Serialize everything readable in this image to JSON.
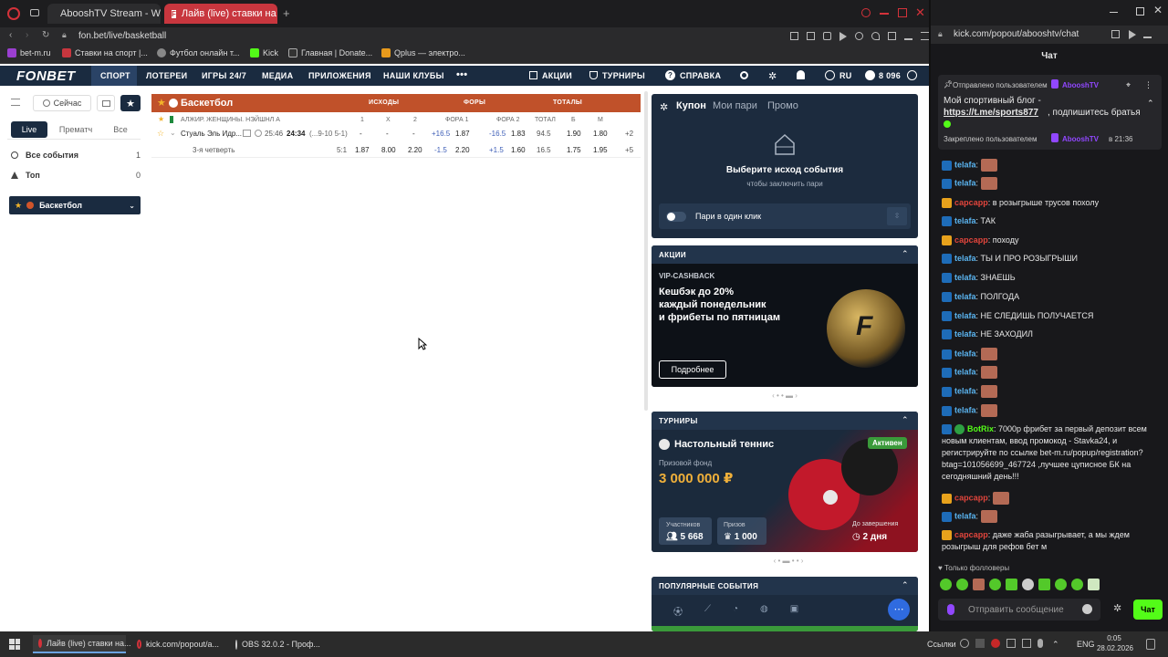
{
  "browser_left": {
    "tabs": [
      {
        "label": "AbooshTV Stream - Watch"
      },
      {
        "label": "Лайв (live) ставки на Баск"
      }
    ],
    "url": "fon.bet/live/basketball",
    "bookmarks": [
      {
        "label": "bet-m.ru"
      },
      {
        "label": "Ставки на спорт |..."
      },
      {
        "label": "Футбол онлайн т..."
      },
      {
        "label": "Kick"
      },
      {
        "label": "Главная | Donate..."
      },
      {
        "label": "Qplus — электро..."
      }
    ]
  },
  "site": {
    "logo": "FONBET",
    "nav": [
      "СПОРТ",
      "ЛОТЕРЕИ",
      "ИГРЫ 24/7",
      "МЕДИА",
      "ПРИЛОЖЕНИЯ",
      "НАШИ КЛУБЫ",
      "•••"
    ],
    "nav_right": [
      "АКЦИИ",
      "ТУРНИРЫ",
      "СПРАВКА"
    ],
    "lang": "RU",
    "balance": "8 096"
  },
  "sidebar": {
    "now_label": "Сейчас",
    "tabs": [
      "Live",
      "Прематч",
      "Все"
    ],
    "items": [
      {
        "label": "Все события",
        "count": "1"
      },
      {
        "label": "Топ",
        "count": "0"
      }
    ],
    "sport": "Баскетбол"
  },
  "board": {
    "sport_title": "Баскетбол",
    "groups": [
      "ИСХОДЫ",
      "ФОРЫ",
      "ТОТАЛЫ"
    ],
    "league": "АЛЖИР. ЖЕНЩИНЫ. НЭЙШНЛ А",
    "cols": [
      "1",
      "X",
      "2",
      "ФОРА 1",
      "ФОРА 2",
      "ТОТАЛ",
      "Б",
      "М"
    ],
    "event": {
      "name": "Стуаль Эль Идр...",
      "score": "25:46",
      "time": "24:34",
      "periods": "(...9-10 5-1)",
      "odds": [
        "-",
        "-",
        "-",
        "+16.5",
        "1.87",
        "-16.5",
        "1.83",
        "94.5",
        "1.90",
        "1.80",
        "+2"
      ]
    },
    "period_row": {
      "label": "3-я четверть",
      "score": "5:1",
      "odds": [
        "1.87",
        "8.00",
        "2.20",
        "-1.5",
        "2.20",
        "+1.5",
        "1.60",
        "16.5",
        "1.75",
        "1.95",
        "+5"
      ]
    }
  },
  "coupon": {
    "tabs": [
      "Купон",
      "Мои пари",
      "Промо"
    ],
    "title": "Выберите исход события",
    "subtitle": "чтобы заключить пари",
    "one_click": "Пари в один клик"
  },
  "promos": {
    "header": "АКЦИИ",
    "tag": "VIP-CASHBACK",
    "text": "Кешбэк до 20%\nкаждый понедельник\nи фрибеты по пятницам",
    "button": "Подробнее"
  },
  "tournaments": {
    "header": "ТУРНИРЫ",
    "name": "Настольный теннис",
    "badge": "Активен",
    "fund_label": "Призовой фонд",
    "fund": "3 000 000 ₽",
    "participants_label": "Участников",
    "participants": "5 668",
    "prizes_label": "Призов",
    "prizes": "1 000",
    "end_label": "До завершения",
    "end": "2 дня"
  },
  "popular": {
    "header": "ПОПУЛЯРНЫЕ СОБЫТИЯ"
  },
  "browser_right": {
    "url": "kick.com/popout/abooshtv/chat",
    "title": "Чат",
    "pinned_by": "Отправлено пользователем",
    "pinned_user": "AbooshTV",
    "pinned_text_1": "Мой спортивный блог -",
    "pinned_link": "https://t.me/sports877",
    "pinned_text_2": ", подпишитесь братья",
    "pinned_footer_pre": "Закреплено пользователем",
    "pinned_footer_user": "AbooshTV",
    "pinned_footer_time": "в 21:36",
    "messages": [
      {
        "user": "telafa",
        "text": ""
      },
      {
        "user": "telafa",
        "text": ""
      },
      {
        "user": "сарсарр",
        "text": "в розыгрыше трусов похолу"
      },
      {
        "user": "telafa",
        "text": "ТАК"
      },
      {
        "user": "сарсарр",
        "text": "походу"
      },
      {
        "user": "telafa",
        "text": "ТЫ И ПРО РОЗЫГРЫШИ"
      },
      {
        "user": "telafa",
        "text": "ЗНАЕШЬ"
      },
      {
        "user": "telafa",
        "text": "ПОЛГОДА"
      },
      {
        "user": "telafa",
        "text": "НЕ СЛЕДИШЬ ПОЛУЧАЕТСЯ"
      },
      {
        "user": "telafa",
        "text": "НЕ ЗАХОДИЛ"
      },
      {
        "user": "telafa",
        "text": ""
      },
      {
        "user": "telafa",
        "text": ""
      },
      {
        "user": "telafa",
        "text": ""
      },
      {
        "user": "telafa",
        "text": ""
      }
    ],
    "bot_user": "BotRix",
    "bot_text": "7000р фрибет за первый депозит всем новым клиентам, ввод промокод - Stavka24, и регистрируйте по ссылке bet-m.ru/popup/registration?btag=101056699_467724 ,лучшее цуписное БК на сегодняшний день!!!",
    "tail": [
      {
        "user": "сарсарр",
        "text": ""
      },
      {
        "user": "telafa",
        "text": ""
      },
      {
        "user": "сарсарр",
        "text": "даже жаба разыгрывает, а мы ждем розыгрыш для рефов бет м"
      }
    ],
    "followers_only": "Только фолловеры",
    "input_placeholder": "Отправить сообщение",
    "send": "Чат"
  },
  "taskbar": {
    "apps": [
      "Лайв (live) ставки на...",
      "kick.com/popout/a...",
      "OBS 32.0.2 - Проф..."
    ],
    "links": "Ссылки",
    "lang": "ENG",
    "time": "0:05",
    "date": "28.02.2026"
  }
}
